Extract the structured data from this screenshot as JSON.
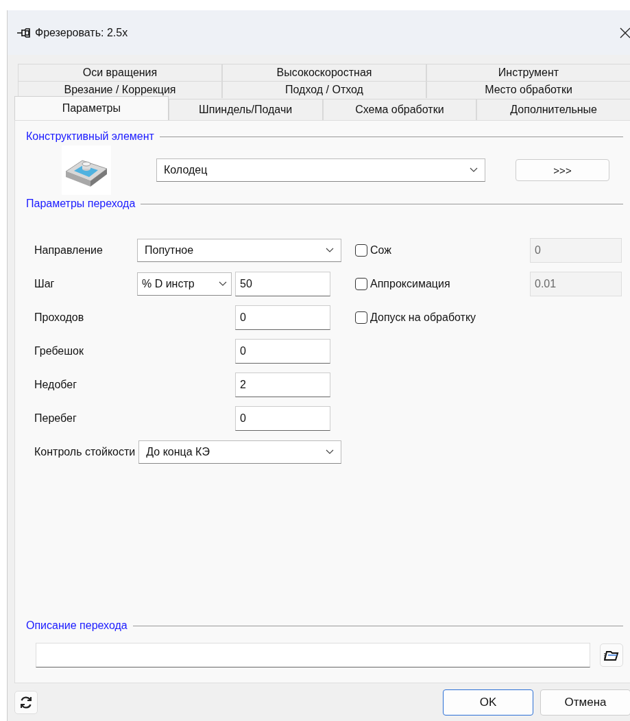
{
  "window": {
    "title": "Фрезеровать: 2.5x"
  },
  "tab_rows": [
    [
      {
        "label": "Оси вращения",
        "selected": false
      },
      {
        "label": "Высокоскоростная",
        "selected": false
      },
      {
        "label": "Инструмент",
        "selected": false
      }
    ],
    [
      {
        "label": "Врезание / Коррекция",
        "selected": false
      },
      {
        "label": "Подход / Отход",
        "selected": false
      },
      {
        "label": "Место обработки",
        "selected": false
      }
    ],
    [
      {
        "label": "Параметры",
        "selected": true
      },
      {
        "label": "Шпиндель/Подачи",
        "selected": false
      },
      {
        "label": "Схема обработки",
        "selected": false
      },
      {
        "label": "Дополнительные",
        "selected": false
      }
    ]
  ],
  "feature": {
    "heading": "Конструктивный элемент",
    "value": "Колодец",
    "button": ">>>"
  },
  "params": {
    "heading": "Параметры перехода",
    "rows": [
      {
        "kind": "combo",
        "label": "Направление",
        "value": "Попутное"
      },
      {
        "kind": "combo_input",
        "label": "Шаг",
        "unit": "% D инстр",
        "value": "50"
      },
      {
        "kind": "input",
        "label": "Проходов",
        "value": "0"
      },
      {
        "kind": "input",
        "label": "Гребешок",
        "value": "0"
      },
      {
        "kind": "input",
        "label": "Недобег",
        "value": "2"
      },
      {
        "kind": "input",
        "label": "Перебег",
        "value": "0"
      },
      {
        "kind": "combo",
        "label": "Контроль стойкости",
        "value": "До конца КЭ"
      }
    ],
    "options": [
      {
        "label": "Сож",
        "checked": false,
        "value": "0"
      },
      {
        "label": "Аппроксимация",
        "checked": false,
        "value": "0.01"
      },
      {
        "label": "Допуск на обработку",
        "checked": false
      }
    ]
  },
  "description": {
    "heading": "Описание перехода"
  },
  "buttons": [
    {
      "label": "OK",
      "default": true
    },
    {
      "label": "Отмена",
      "default": false
    }
  ]
}
